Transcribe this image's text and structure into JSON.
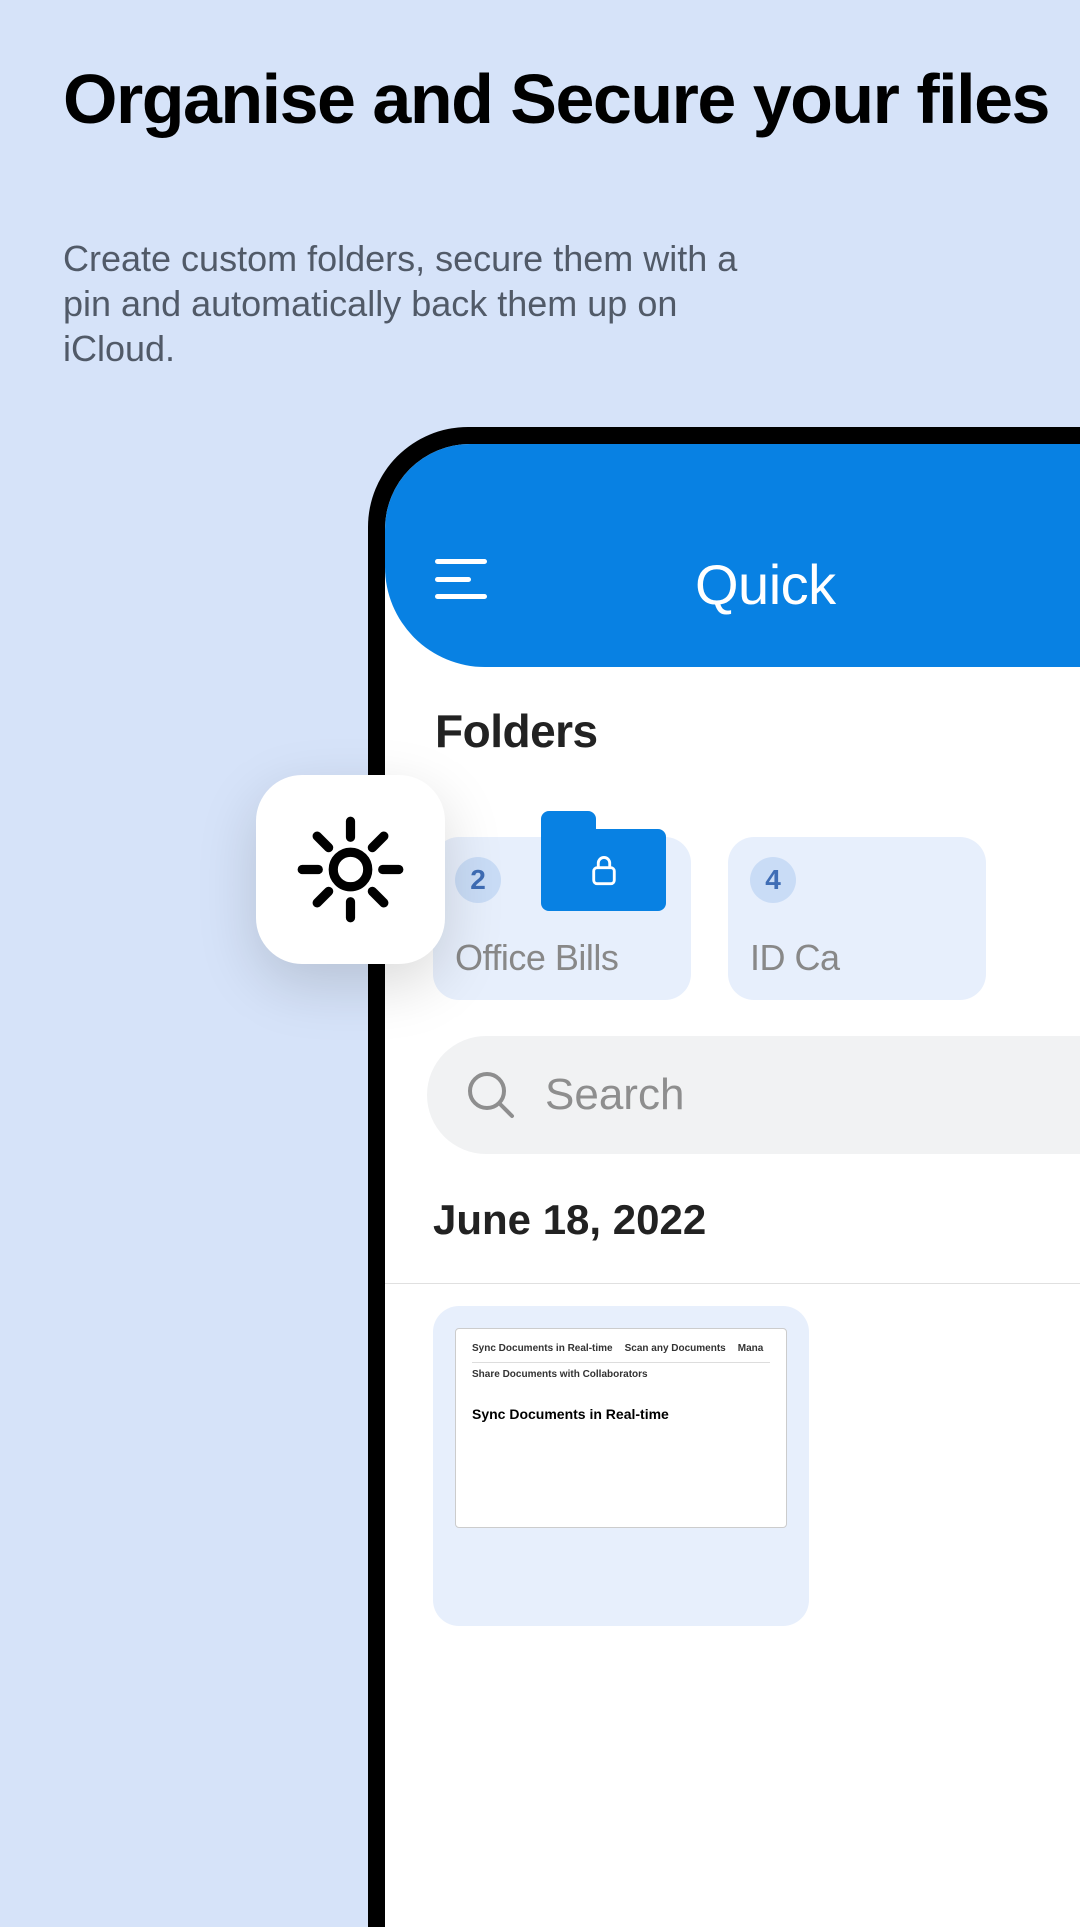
{
  "hero": {
    "title": "Organise and Secure your files",
    "subtitle": "Create custom folders, secure them with a pin and automatically back them up on iCloud."
  },
  "app": {
    "title": "Quick",
    "sections": {
      "folders_label": "Folders",
      "date_label": "June 18, 2022"
    },
    "folders": [
      {
        "count": "2",
        "name": "Office Bills",
        "locked": true
      },
      {
        "count": "4",
        "name": "ID Ca"
      }
    ],
    "search": {
      "placeholder": "Search"
    },
    "doc_preview": {
      "tabs": [
        "Sync Documents in Real-time",
        "Scan any Documents",
        "Mana"
      ],
      "line2": "Share Documents with Collaborators",
      "title": "Sync Documents in Real-time"
    }
  },
  "badge_icon": "brightness-icon"
}
